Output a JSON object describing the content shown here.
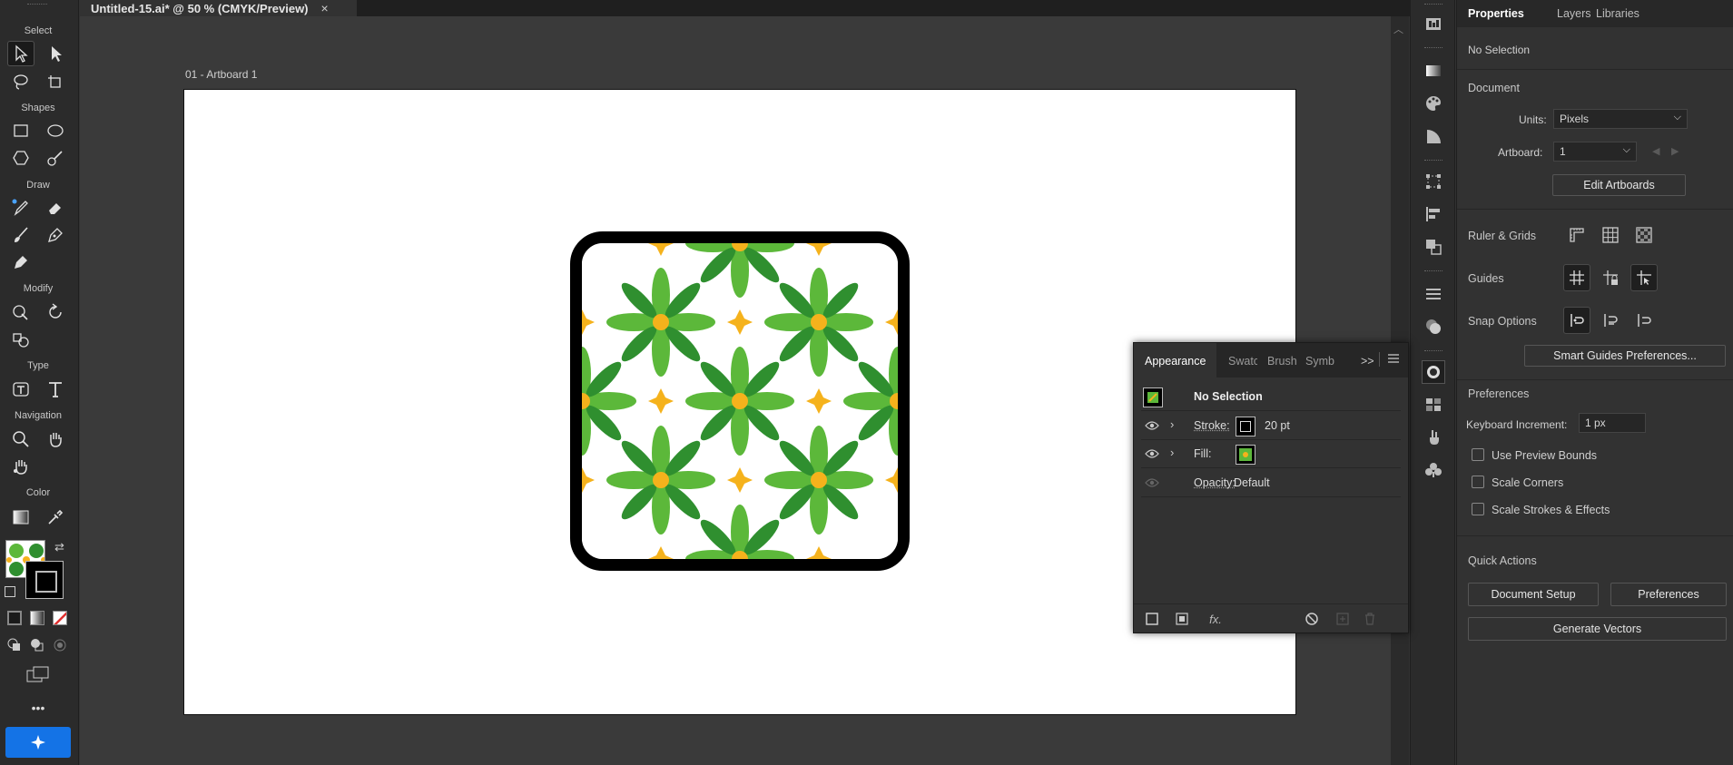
{
  "document": {
    "tab_title": "Untitled-15.ai* @ 50 % (CMYK/Preview)",
    "artboard_label": "01 - Artboard 1"
  },
  "toolbar": {
    "sections": {
      "select": "Select",
      "shapes": "Shapes",
      "draw": "Draw",
      "modify": "Modify",
      "type": "Type",
      "navigation": "Navigation",
      "color": "Color"
    },
    "more_label": "•••"
  },
  "properties_panel": {
    "tabs": [
      "Properties",
      "Layers",
      "Libraries"
    ],
    "selection_status": "No Selection",
    "document": {
      "heading": "Document",
      "units_label": "Units:",
      "units_value": "Pixels",
      "artboard_label": "Artboard:",
      "artboard_value": "1",
      "edit_artboards": "Edit Artboards"
    },
    "ruler_grids": "Ruler & Grids",
    "guides": "Guides",
    "snap_options": "Snap Options",
    "smart_guides_button": "Smart Guides Preferences...",
    "preferences": {
      "heading": "Preferences",
      "keyboard_increment_label": "Keyboard Increment:",
      "keyboard_increment_value": "1 px",
      "use_preview_bounds": "Use Preview Bounds",
      "scale_corners": "Scale Corners",
      "scale_strokes": "Scale Strokes & Effects"
    },
    "quick_actions": {
      "heading": "Quick Actions",
      "document_setup": "Document Setup",
      "preferences": "Preferences",
      "generate_vectors": "Generate Vectors"
    }
  },
  "appearance_panel": {
    "tabs": [
      "Appearance",
      "Swatc",
      "Brush",
      "Symb"
    ],
    "expand": ">>",
    "header": "No Selection",
    "stroke_label": "Stroke:",
    "stroke_value": "20 pt",
    "fill_label": "Fill:",
    "opacity_label": "Opacity:",
    "opacity_value": "Default",
    "fx_label": "fx."
  },
  "colors": {
    "accent": "#1473e6",
    "pattern_green": "#5cb83a",
    "pattern_dark_green": "#2f8f2f",
    "pattern_yellow": "#f5b21c"
  }
}
